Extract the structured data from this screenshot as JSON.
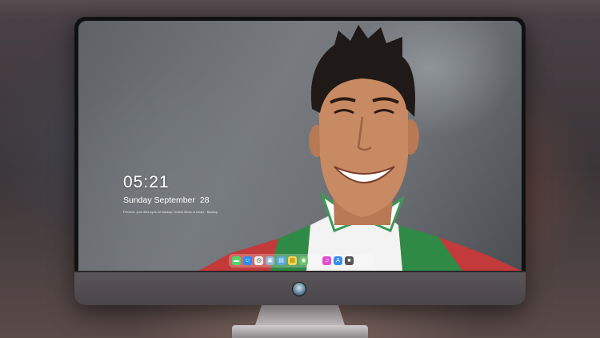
{
  "lockscreen": {
    "time": "05:21",
    "date_weekday_month": "Sunday September",
    "date_day": "28",
    "notice": "Preview: your files sync on backup; review items in folder · Backup"
  },
  "dock": {
    "apps": [
      {
        "name": "messages",
        "glyph": "▬",
        "color": "#4cd964"
      },
      {
        "name": "finder",
        "glyph": "☺",
        "color": "#2a8ef5"
      },
      {
        "name": "clock",
        "glyph": "◷",
        "color": "#f0f0f0"
      },
      {
        "name": "preview",
        "glyph": "▣",
        "color": "#8fb7d6"
      },
      {
        "name": "clapper",
        "glyph": "▤",
        "color": "#5aa8e0"
      },
      {
        "name": "notes",
        "glyph": "▤",
        "color": "#ffd54a"
      },
      {
        "name": "photos",
        "glyph": "◉",
        "color": "#6cc36c"
      },
      {
        "name": "itunes",
        "glyph": "♫",
        "color": "#e04fd0"
      },
      {
        "name": "app-store",
        "glyph": "A",
        "color": "#3a8ff0"
      },
      {
        "name": "camera",
        "glyph": "■",
        "color": "#555555"
      }
    ]
  }
}
